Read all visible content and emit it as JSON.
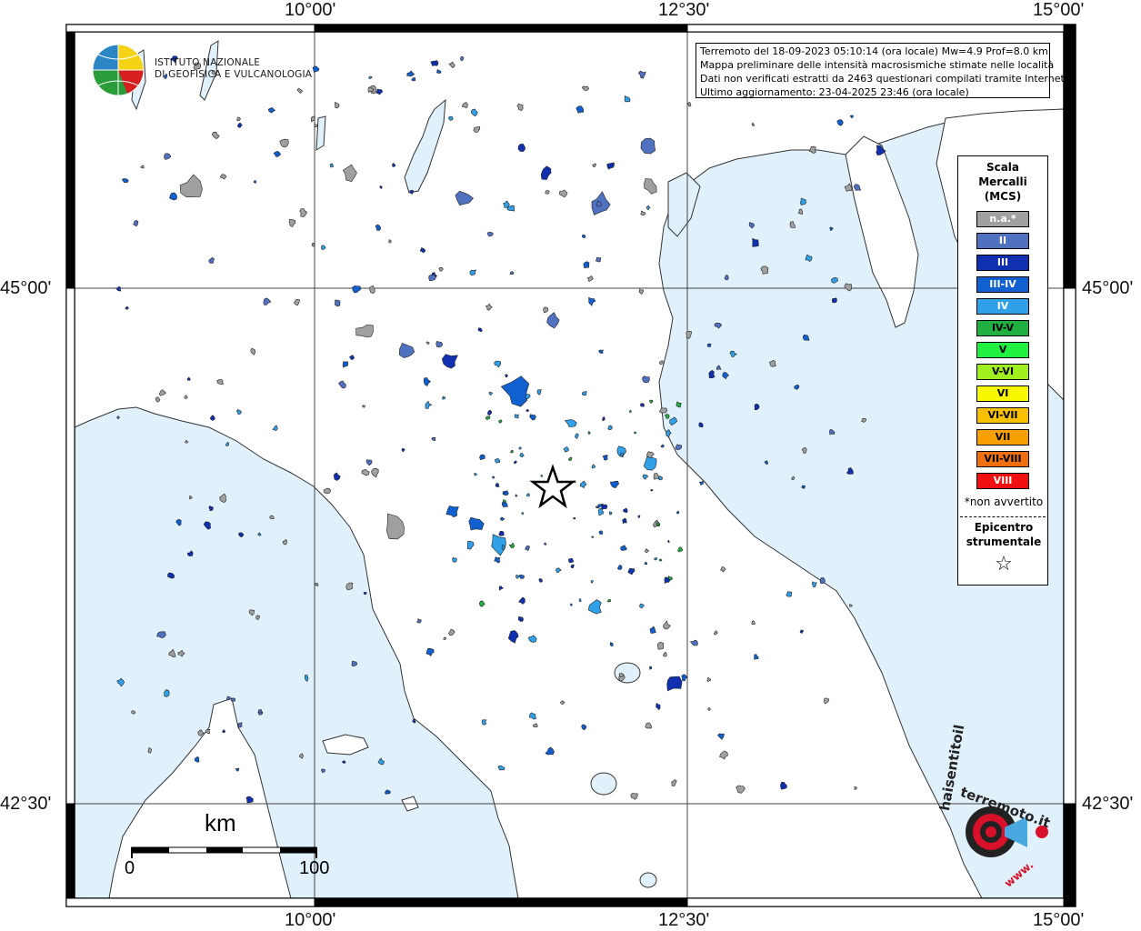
{
  "map": {
    "coords": {
      "top": [
        "10°00'",
        "12°30'",
        "15°00'"
      ],
      "bottom": [
        "10°00'",
        "12°30'",
        "15°00'"
      ],
      "left": [
        "45°00'",
        "42°30'"
      ],
      "right": [
        "45°00'",
        "42°30'"
      ]
    },
    "colors": {
      "sea": "#e1f1fb",
      "land": "#ffffff",
      "na": "#a0a0a0",
      "II": "#5070c0",
      "III": "#1030b0",
      "III-IV": "#1060d0",
      "IV": "#30a0e8",
      "IV-V": "#20b040",
      "epicenter": "#000000"
    }
  },
  "logo": {
    "line1": "ISTITUTO NAZIONALE",
    "line2": "DI GEOFISICA E VULCANOLOGIA"
  },
  "info": {
    "line1": "Terremoto del 18-09-2023 05:10:14 (ora locale) Mw=4.9 Prof=8.0 km",
    "line2": "Mappa preliminare delle intensità macrosismiche stimate nelle località",
    "line3": "Dati non verificati estratti da 2463 questionari compilati tramite Internet.",
    "line4": "Ultimo aggiornamento: 23-04-2025 23:46 (ora locale)"
  },
  "legend": {
    "title": "Scala\nMercalli\n(MCS)",
    "title_lines": [
      "Scala",
      "Mercalli",
      "(MCS)"
    ],
    "items": [
      {
        "label": "n.a.*",
        "color": "#a0a0a0",
        "text_color": "#ffffff"
      },
      {
        "label": "II",
        "color": "#5070c0",
        "text_color": "#ffffff"
      },
      {
        "label": "III",
        "color": "#1030b0",
        "text_color": "#ffffff"
      },
      {
        "label": "III-IV",
        "color": "#1060d0",
        "text_color": "#ffffff"
      },
      {
        "label": "IV",
        "color": "#30a0e8",
        "text_color": "#ffffff"
      },
      {
        "label": "IV-V",
        "color": "#20b040",
        "text_color": "#000000"
      },
      {
        "label": "V",
        "color": "#20f040",
        "text_color": "#000000"
      },
      {
        "label": "V-VI",
        "color": "#a0f020",
        "text_color": "#000000"
      },
      {
        "label": "VI",
        "color": "#f8f800",
        "text_color": "#000000"
      },
      {
        "label": "VI-VII",
        "color": "#f8c000",
        "text_color": "#000000"
      },
      {
        "label": "VII",
        "color": "#f8a000",
        "text_color": "#000000"
      },
      {
        "label": "VII-VIII",
        "color": "#f07010",
        "text_color": "#000000"
      },
      {
        "label": "VIII",
        "color": "#f01010",
        "text_color": "#ffffff"
      }
    ],
    "note": "*non avvertito",
    "epicenter_lines": [
      "Epicentro",
      "strumentale"
    ],
    "epicenter_symbol": "☆"
  },
  "scalebar": {
    "unit": "km",
    "start": "0",
    "end": "100"
  },
  "hsentito": {
    "text": "haisentitoilterremoto.it",
    "part1": "www.",
    "part2": "haisentitoil",
    "part3": "terremoto.it"
  }
}
